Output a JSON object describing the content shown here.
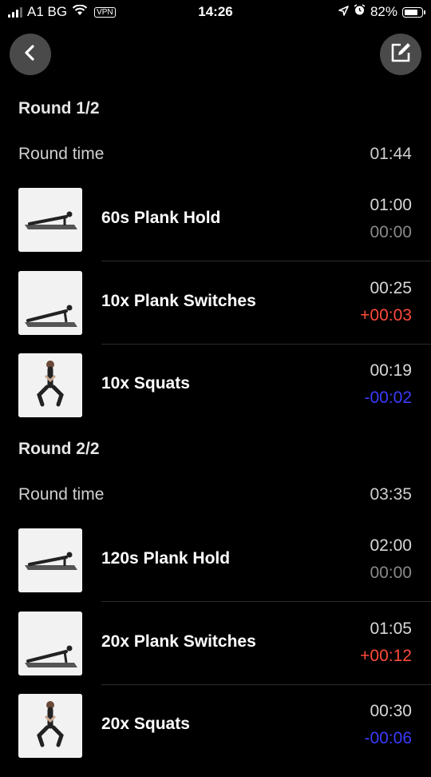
{
  "status_bar": {
    "carrier": "A1 BG",
    "vpn": "VPN",
    "time": "14:26",
    "battery": "82%",
    "battery_level": 0.82
  },
  "header": {
    "back_icon": "chevron-left-icon",
    "edit_icon": "edit-icon"
  },
  "colors": {
    "background": "#000000",
    "over_time": "#ff4a3a",
    "under_time": "#3b3bff",
    "neutral_time": "#8a8a8a"
  },
  "rounds": [
    {
      "title": "Round 1/2",
      "round_time_label": "Round time",
      "round_time": "01:44",
      "exercises": [
        {
          "name": "60s Plank Hold",
          "time": "01:00",
          "diff": "00:00",
          "diff_type": "neutral",
          "image": "plank-hold-image"
        },
        {
          "name": "10x Plank Switches",
          "time": "00:25",
          "diff": "+00:03",
          "diff_type": "over",
          "image": "plank-switches-image"
        },
        {
          "name": "10x Squats",
          "time": "00:19",
          "diff": "-00:02",
          "diff_type": "under",
          "image": "squats-image"
        }
      ]
    },
    {
      "title": "Round 2/2",
      "round_time_label": "Round time",
      "round_time": "03:35",
      "exercises": [
        {
          "name": "120s Plank Hold",
          "time": "02:00",
          "diff": "00:00",
          "diff_type": "neutral",
          "image": "plank-hold-image"
        },
        {
          "name": "20x Plank Switches",
          "time": "01:05",
          "diff": "+00:12",
          "diff_type": "over",
          "image": "plank-switches-image"
        },
        {
          "name": "20x Squats",
          "time": "00:30",
          "diff": "-00:06",
          "diff_type": "under",
          "image": "squats-image"
        }
      ]
    }
  ]
}
